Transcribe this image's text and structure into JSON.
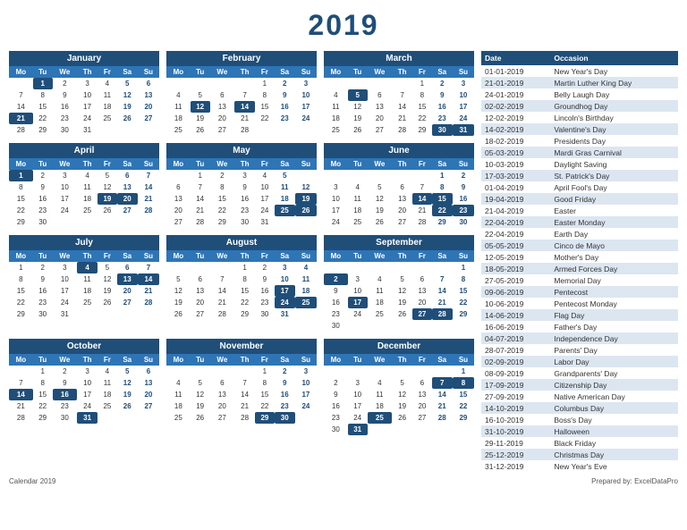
{
  "title": "2019",
  "months": [
    {
      "name": "January",
      "weeks": [
        [
          "",
          "1",
          "2",
          "3",
          "4",
          "5",
          "6"
        ],
        [
          "7",
          "8",
          "9",
          "10",
          "11",
          "12",
          "13"
        ],
        [
          "14",
          "15",
          "16",
          "17",
          "18",
          "19",
          "20"
        ],
        [
          "21",
          "22",
          "23",
          "24",
          "25",
          "26",
          "27"
        ],
        [
          "28",
          "29",
          "30",
          "31",
          "",
          "",
          ""
        ]
      ],
      "highlights": {
        "col5": [
          "5",
          "12",
          "19",
          "26"
        ],
        "col6": [
          "6",
          "13",
          "20",
          "27"
        ],
        "blue": [],
        "dark": [
          "1"
        ]
      }
    },
    {
      "name": "February",
      "weeks": [
        [
          "",
          "",
          "",
          "",
          "1",
          "2",
          "3"
        ],
        [
          "4",
          "5",
          "6",
          "7",
          "8",
          "9",
          "10"
        ],
        [
          "11",
          "12",
          "13",
          "14",
          "15",
          "16",
          "17"
        ],
        [
          "18",
          "19",
          "20",
          "21",
          "22",
          "23",
          "24"
        ],
        [
          "25",
          "26",
          "27",
          "28",
          "",
          "",
          ""
        ]
      ],
      "highlights": {}
    },
    {
      "name": "March",
      "weeks": [
        [
          "",
          "",
          "",
          "",
          "1",
          "2",
          "3"
        ],
        [
          "4",
          "5",
          "6",
          "7",
          "8",
          "9",
          "10"
        ],
        [
          "11",
          "12",
          "13",
          "14",
          "15",
          "16",
          "17"
        ],
        [
          "18",
          "19",
          "20",
          "21",
          "22",
          "23",
          "24"
        ],
        [
          "25",
          "26",
          "27",
          "28",
          "29",
          "30",
          "31"
        ]
      ],
      "highlights": {}
    },
    {
      "name": "April",
      "weeks": [
        [
          "1",
          "2",
          "3",
          "4",
          "5",
          "6",
          "7"
        ],
        [
          "8",
          "9",
          "10",
          "11",
          "12",
          "13",
          "14"
        ],
        [
          "15",
          "16",
          "17",
          "18",
          "19",
          "20",
          "21"
        ],
        [
          "22",
          "23",
          "24",
          "25",
          "26",
          "27",
          "28"
        ],
        [
          "29",
          "30",
          "",
          "",
          "",
          "",
          ""
        ]
      ],
      "highlights": {}
    },
    {
      "name": "May",
      "weeks": [
        [
          "",
          "1",
          "2",
          "3",
          "4",
          "5",
          ""
        ],
        [
          "6",
          "7",
          "8",
          "9",
          "10",
          "11",
          "12"
        ],
        [
          "13",
          "14",
          "15",
          "16",
          "17",
          "18",
          "19"
        ],
        [
          "20",
          "21",
          "22",
          "23",
          "24",
          "25",
          "26"
        ],
        [
          "27",
          "28",
          "29",
          "30",
          "31",
          "",
          ""
        ]
      ],
      "highlights": {}
    },
    {
      "name": "June",
      "weeks": [
        [
          "",
          "",
          "",
          "",
          "",
          "1",
          "2"
        ],
        [
          "3",
          "4",
          "5",
          "6",
          "7",
          "8",
          "9"
        ],
        [
          "10",
          "11",
          "12",
          "13",
          "14",
          "15",
          "16"
        ],
        [
          "17",
          "18",
          "19",
          "20",
          "21",
          "22",
          "23"
        ],
        [
          "24",
          "25",
          "26",
          "27",
          "28",
          "29",
          "30"
        ]
      ],
      "highlights": {}
    },
    {
      "name": "July",
      "weeks": [
        [
          "1",
          "2",
          "3",
          "4",
          "5",
          "6",
          "7"
        ],
        [
          "8",
          "9",
          "10",
          "11",
          "12",
          "13",
          "14"
        ],
        [
          "15",
          "16",
          "17",
          "18",
          "19",
          "20",
          "21"
        ],
        [
          "22",
          "23",
          "24",
          "25",
          "26",
          "27",
          "28"
        ],
        [
          "29",
          "30",
          "31",
          "",
          "",
          "",
          ""
        ]
      ],
      "highlights": {}
    },
    {
      "name": "August",
      "weeks": [
        [
          "",
          "",
          "",
          "1",
          "2",
          "3",
          "4"
        ],
        [
          "5",
          "6",
          "7",
          "8",
          "9",
          "10",
          "11"
        ],
        [
          "12",
          "13",
          "14",
          "15",
          "16",
          "17",
          "18"
        ],
        [
          "19",
          "20",
          "21",
          "22",
          "23",
          "24",
          "25"
        ],
        [
          "26",
          "27",
          "28",
          "29",
          "30",
          "31",
          ""
        ]
      ],
      "highlights": {}
    },
    {
      "name": "September",
      "weeks": [
        [
          "",
          "",
          "",
          "",
          "",
          "",
          "1"
        ],
        [
          "2",
          "3",
          "4",
          "5",
          "6",
          "7",
          "8"
        ],
        [
          "9",
          "10",
          "11",
          "12",
          "13",
          "14",
          "15"
        ],
        [
          "16",
          "17",
          "18",
          "19",
          "20",
          "21",
          "22"
        ],
        [
          "23",
          "24",
          "25",
          "26",
          "27",
          "28",
          "29"
        ],
        [
          "30",
          "",
          "",
          "",
          "",
          "",
          ""
        ]
      ],
      "highlights": {}
    },
    {
      "name": "October",
      "weeks": [
        [
          "",
          "1",
          "2",
          "3",
          "4",
          "5",
          "6"
        ],
        [
          "7",
          "8",
          "9",
          "10",
          "11",
          "12",
          "13"
        ],
        [
          "14",
          "15",
          "16",
          "17",
          "18",
          "19",
          "20"
        ],
        [
          "21",
          "22",
          "23",
          "24",
          "25",
          "26",
          "27"
        ],
        [
          "28",
          "29",
          "30",
          "31",
          "",
          "",
          ""
        ]
      ],
      "highlights": {}
    },
    {
      "name": "November",
      "weeks": [
        [
          "",
          "",
          "",
          "",
          "1",
          "2",
          "3"
        ],
        [
          "4",
          "5",
          "6",
          "7",
          "8",
          "9",
          "10"
        ],
        [
          "11",
          "12",
          "13",
          "14",
          "15",
          "16",
          "17"
        ],
        [
          "18",
          "19",
          "20",
          "21",
          "22",
          "23",
          "24"
        ],
        [
          "25",
          "26",
          "27",
          "28",
          "29",
          "30",
          ""
        ]
      ],
      "highlights": {}
    },
    {
      "name": "December",
      "weeks": [
        [
          "",
          "",
          "",
          "",
          "",
          "",
          "1"
        ],
        [
          "2",
          "3",
          "4",
          "5",
          "6",
          "7",
          "8"
        ],
        [
          "9",
          "10",
          "11",
          "12",
          "13",
          "14",
          "15"
        ],
        [
          "16",
          "17",
          "18",
          "19",
          "20",
          "21",
          "22"
        ],
        [
          "23",
          "24",
          "25",
          "26",
          "27",
          "28",
          "29"
        ],
        [
          "30",
          "31",
          "",
          "",
          "",
          "",
          ""
        ]
      ],
      "highlights": {}
    }
  ],
  "occasions": [
    {
      "date": "01-01-2019",
      "name": "New Year's Day"
    },
    {
      "date": "21-01-2019",
      "name": "Martin Luther King Day"
    },
    {
      "date": "24-01-2019",
      "name": "Belly Laugh Day"
    },
    {
      "date": "02-02-2019",
      "name": "Groundhog Day"
    },
    {
      "date": "12-02-2019",
      "name": "Lincoln's Birthday"
    },
    {
      "date": "14-02-2019",
      "name": "Valentine's Day"
    },
    {
      "date": "18-02-2019",
      "name": "Presidents Day"
    },
    {
      "date": "05-03-2019",
      "name": "Mardi Gras Carnival"
    },
    {
      "date": "10-03-2019",
      "name": "Daylight Saving"
    },
    {
      "date": "17-03-2019",
      "name": "St. Patrick's Day"
    },
    {
      "date": "01-04-2019",
      "name": "April Fool's Day"
    },
    {
      "date": "19-04-2019",
      "name": "Good Friday"
    },
    {
      "date": "21-04-2019",
      "name": "Easter"
    },
    {
      "date": "22-04-2019",
      "name": "Easter Monday"
    },
    {
      "date": "22-04-2019",
      "name": "Earth Day"
    },
    {
      "date": "05-05-2019",
      "name": "Cinco de Mayo"
    },
    {
      "date": "12-05-2019",
      "name": "Mother's Day"
    },
    {
      "date": "18-05-2019",
      "name": "Armed Forces Day"
    },
    {
      "date": "27-05-2019",
      "name": "Memorial Day"
    },
    {
      "date": "09-06-2019",
      "name": "Pentecost"
    },
    {
      "date": "10-06-2019",
      "name": "Pentecost Monday"
    },
    {
      "date": "14-06-2019",
      "name": "Flag Day"
    },
    {
      "date": "16-06-2019",
      "name": "Father's Day"
    },
    {
      "date": "04-07-2019",
      "name": "Independence Day"
    },
    {
      "date": "28-07-2019",
      "name": "Parents' Day"
    },
    {
      "date": "02-09-2019",
      "name": "Labor Day"
    },
    {
      "date": "08-09-2019",
      "name": "Grandparents' Day"
    },
    {
      "date": "17-09-2019",
      "name": "Citizenship Day"
    },
    {
      "date": "27-09-2019",
      "name": "Native American Day"
    },
    {
      "date": "14-10-2019",
      "name": "Columbus Day"
    },
    {
      "date": "16-10-2019",
      "name": "Boss's Day"
    },
    {
      "date": "31-10-2019",
      "name": "Halloween"
    },
    {
      "date": "29-11-2019",
      "name": "Black Friday"
    },
    {
      "date": "25-12-2019",
      "name": "Christmas Day"
    },
    {
      "date": "31-12-2019",
      "name": "New Year's Eve"
    }
  ],
  "footer": {
    "left": "Calendar 2019",
    "right": "Prepared by: ExcelDataPro"
  },
  "occasions_headers": {
    "date": "Date",
    "occasion": "Occasion"
  }
}
